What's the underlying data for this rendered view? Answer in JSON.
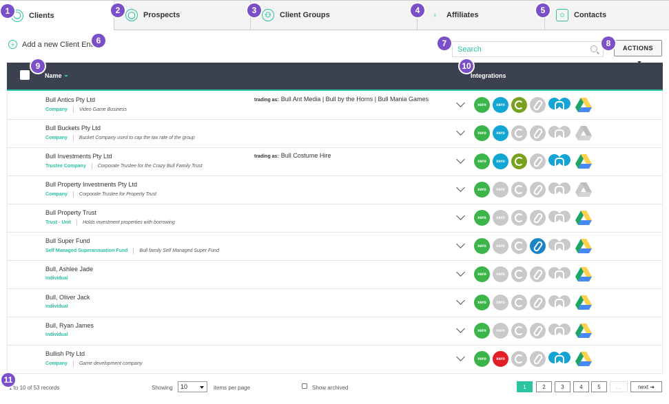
{
  "tabs": [
    {
      "label": "Clients",
      "badge": "1"
    },
    {
      "label": "Prospects",
      "badge": "2"
    },
    {
      "label": "Client Groups",
      "badge": "3"
    },
    {
      "label": "Affiliates",
      "badge": "4"
    },
    {
      "label": "Contacts",
      "badge": "5"
    }
  ],
  "badges": {
    "add": "6",
    "search": "7",
    "actions": "8",
    "name": "9",
    "integrations": "10",
    "footer": "11"
  },
  "add_entity_label": "Add a new Client Entity",
  "search": {
    "placeholder": "Search"
  },
  "actions_label": "ACTIONS",
  "table": {
    "columns": {
      "name": "Name",
      "integrations": "Integrations"
    },
    "trading_label": "trading as:",
    "rows": [
      {
        "name": "Bull Antics Pty Ltd",
        "type": "Company",
        "desc": "Video Game Business",
        "trading": "Bull Ant Media | Bull by the Horns | Bull Mania Games",
        "icons": [
          "xero-green",
          "xero-blue",
          "olive",
          "link-grey",
          "hub-blue",
          "drive"
        ]
      },
      {
        "name": "Bull Buckets Pty Ltd",
        "type": "Company",
        "desc": "Bucket Company used to cap the tax rate of the group",
        "trading": "",
        "icons": [
          "xero-green",
          "xero-blue",
          "grey-c",
          "link-grey",
          "hub-grey",
          "drive-grey"
        ]
      },
      {
        "name": "Bull Investments Pty Ltd",
        "type": "Trustee Company",
        "desc": "Corporate Trustee for the Crazy Bull Family Trust",
        "trading": "Bull Costume Hire",
        "icons": [
          "xero-green",
          "xero-blue",
          "olive",
          "link-grey",
          "hub-blue",
          "drive"
        ]
      },
      {
        "name": "Bull Property Investments Pty Ltd",
        "type": "Company",
        "desc": "Corporate Trustee for Property Trust",
        "trading": "",
        "icons": [
          "xero-green",
          "xero-grey",
          "grey-c",
          "link-grey",
          "hub-grey",
          "drive-grey"
        ]
      },
      {
        "name": "Bull Property Trust",
        "type": "Trust - Unit",
        "desc": "Holds investment properties with borrowing",
        "trading": "",
        "icons": [
          "xero-green",
          "xero-grey",
          "grey-c",
          "link-grey",
          "hub-grey",
          "drive"
        ]
      },
      {
        "name": "Bull Super Fund",
        "type": "Self Managed Superannuation Fund",
        "desc": "Bull family Self Managed Super Fund",
        "trading": "",
        "icons": [
          "xero-green",
          "xero-grey",
          "grey-c",
          "link-blue",
          "hub-grey",
          "drive"
        ]
      },
      {
        "name": "Bull, Ashlee Jade",
        "type": "Individual",
        "desc": "",
        "trading": "",
        "icons": [
          "xero-green",
          "xero-grey",
          "grey-c",
          "link-grey",
          "hub-grey",
          "drive"
        ]
      },
      {
        "name": "Bull, Oliver Jack",
        "type": "Individual",
        "desc": "",
        "trading": "",
        "icons": [
          "xero-green",
          "xero-grey",
          "grey-c",
          "link-grey",
          "hub-grey",
          "drive"
        ]
      },
      {
        "name": "Bull, Ryan James",
        "type": "Individual",
        "desc": "",
        "trading": "",
        "icons": [
          "xero-green",
          "xero-grey",
          "grey-c",
          "link-grey",
          "hub-grey",
          "drive"
        ]
      },
      {
        "name": "Bullish Pty Ltd",
        "type": "Company",
        "desc": "Game development company",
        "trading": "",
        "icons": [
          "xero-green",
          "xero-red",
          "grey-c",
          "link-grey",
          "hub-blue",
          "drive"
        ]
      }
    ]
  },
  "footer": {
    "records": "1 to 10 of 53 records",
    "showing": "Showing",
    "per_page_value": "10",
    "per_page_label": "items per page",
    "show_archived": "Show archived",
    "pages": [
      "1",
      "2",
      "3",
      "4",
      "5",
      "...",
      "next ➔"
    ]
  },
  "icon_text": {
    "xero": "xero"
  },
  "colors": {
    "accent": "#2bc3a0",
    "header_bg": "#3c4150",
    "badge": "#7b4fc7"
  }
}
